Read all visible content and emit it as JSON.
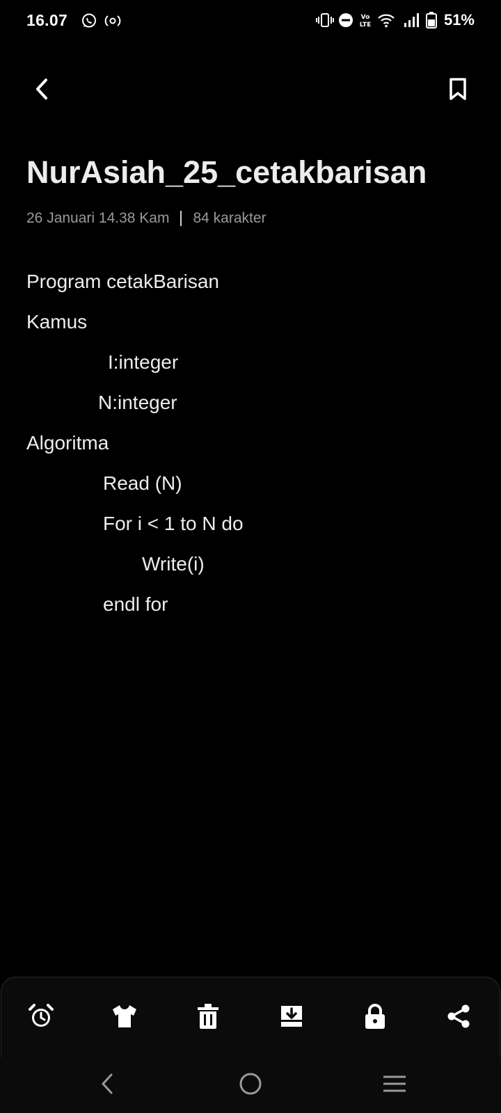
{
  "status_bar": {
    "time": "16.07",
    "battery": "51%",
    "left_icons": [
      "whatsapp-icon",
      "hotspot-icon"
    ],
    "right_icons": [
      "vibrate-icon",
      "do-not-disturb-icon",
      "volte-icon",
      "wifi-icon",
      "signal-icon",
      "battery-icon"
    ]
  },
  "top_bar": {
    "back_icon": "chevron-left-icon",
    "bookmark_icon": "bookmark-icon"
  },
  "note": {
    "title": "NurAsiah_25_cetakbarisan",
    "date": "26 Januari 14.38 Kam",
    "char_count": "84 karakter",
    "lines": [
      {
        "text": "Program cetakBarisan",
        "indent": 0
      },
      {
        "text": "Kamus",
        "indent": 0
      },
      {
        "text": "I:integer",
        "indent": 117
      },
      {
        "text": "N:integer",
        "indent": 103
      },
      {
        "text": "Algoritma",
        "indent": 0
      },
      {
        "text": "Read (N)",
        "indent": 110
      },
      {
        "text": "For i < 1 to N do",
        "indent": 110
      },
      {
        "text": "Write(i)",
        "indent": 166
      },
      {
        "text": "endl for",
        "indent": 110
      }
    ]
  },
  "toolbar": {
    "items": [
      "alarm-icon",
      "theme-shirt-icon",
      "trash-icon",
      "save-download-icon",
      "lock-icon",
      "share-icon"
    ]
  },
  "nav_bar": {
    "items": [
      "nav-back-icon",
      "nav-home-icon",
      "nav-recents-icon"
    ]
  }
}
